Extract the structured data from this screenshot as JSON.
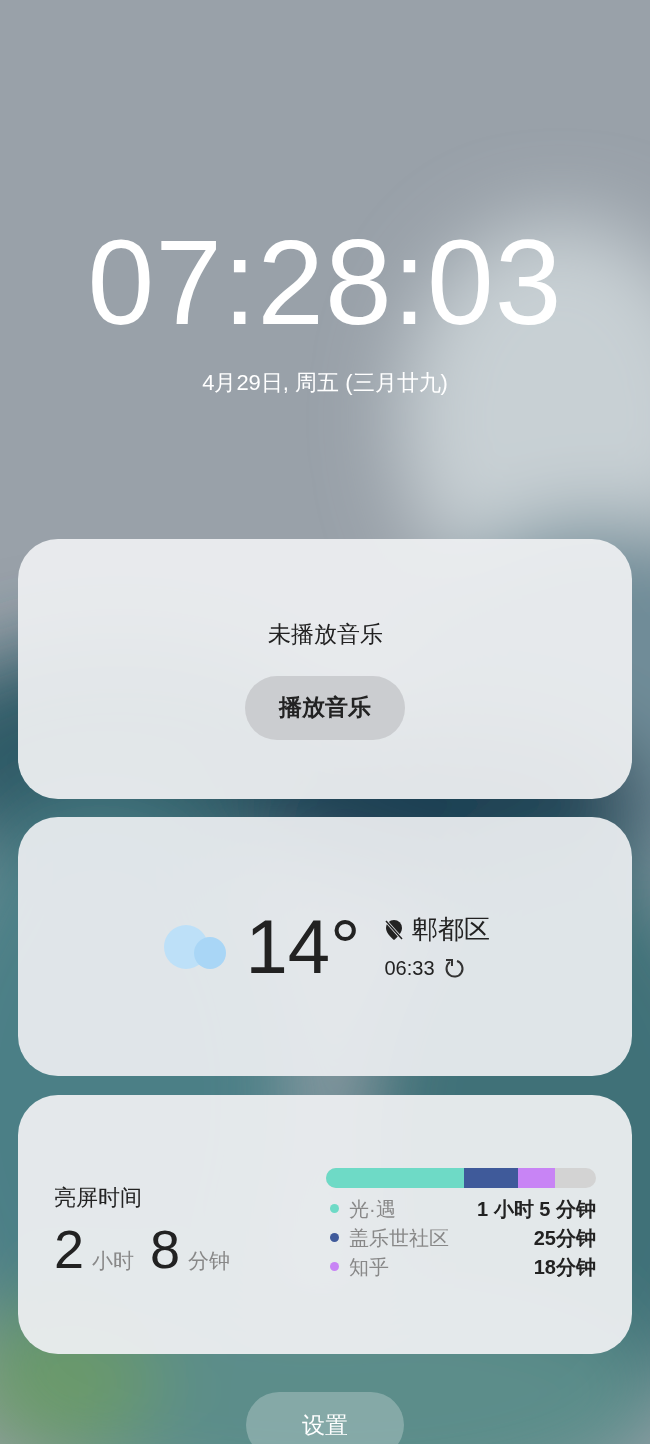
{
  "clock": {
    "time": "07:28:03",
    "date": "4月29日, 周五 (三月廿九)"
  },
  "music": {
    "status": "未播放音乐",
    "button": "播放音乐"
  },
  "weather": {
    "temperature": "14°",
    "location": "郫都区",
    "updated": "06:33"
  },
  "screen_time": {
    "title": "亮屏时间",
    "hours": "2",
    "hours_unit": "小时",
    "minutes": "8",
    "minutes_unit": "分钟",
    "apps": [
      {
        "name": "光·遇",
        "duration": "1 小时 5 分钟",
        "color": "#6edac6"
      },
      {
        "name": "盖乐世社区",
        "duration": "25分钟",
        "color": "#3f5a9a"
      },
      {
        "name": "知乎",
        "duration": "18分钟",
        "color": "#c884f5"
      }
    ]
  },
  "settings_button": "设置"
}
